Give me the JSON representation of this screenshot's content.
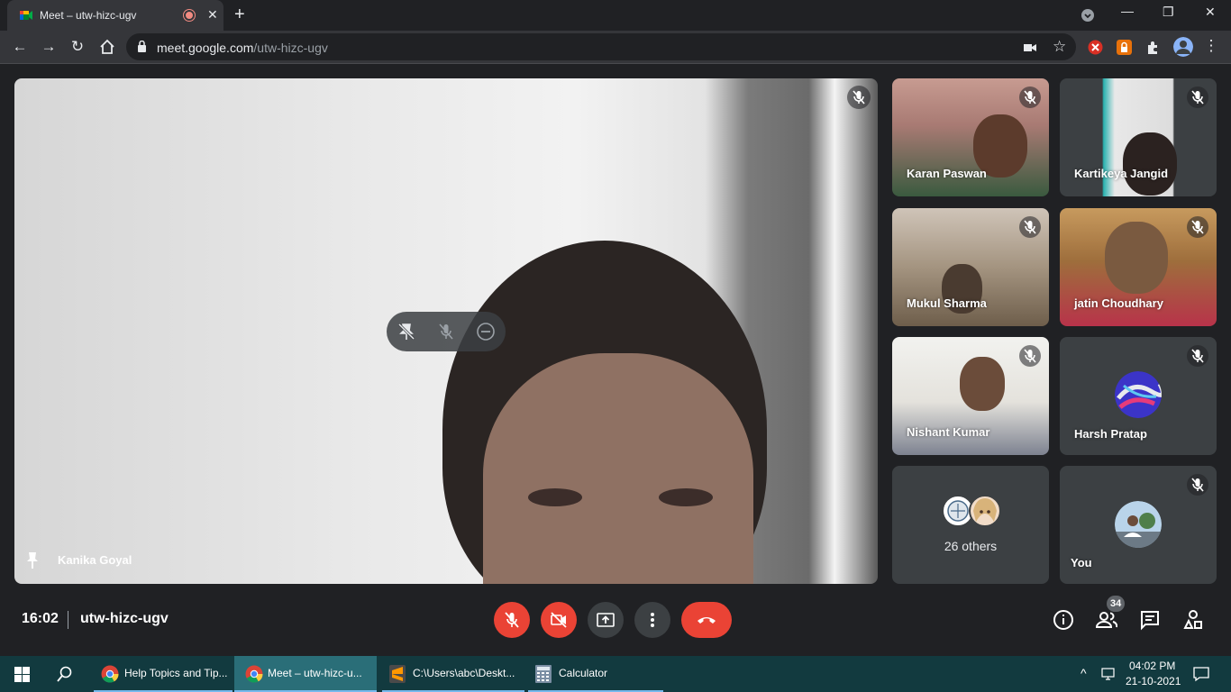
{
  "browser": {
    "tab_title": "Meet – utw-hizc-ugv",
    "url_host": "meet.google.com",
    "url_path": "/utw-hizc-ugv"
  },
  "main_speaker": {
    "name": "Kanika Goyal"
  },
  "tiles": [
    {
      "name": "Karan Paswan"
    },
    {
      "name": "Kartikeya Jangid"
    },
    {
      "name": "Mukul Sharma"
    },
    {
      "name": "jatin Choudhary"
    },
    {
      "name": "Nishant Kumar"
    },
    {
      "name": "Harsh Pratap"
    },
    {
      "name": "26 others"
    },
    {
      "name": "You"
    }
  ],
  "meeting": {
    "time": "16:02",
    "code": "utw-hizc-ugv",
    "participant_count": "34"
  },
  "taskbar": {
    "items": [
      {
        "label": "Help Topics and Tip..."
      },
      {
        "label": "Meet – utw-hizc-u..."
      },
      {
        "label": "C:\\Users\\abc\\Deskt..."
      },
      {
        "label": "Calculator"
      }
    ],
    "time": "04:02 PM",
    "date": "21-10-2021"
  },
  "colors": {
    "accent_red": "#ea4335",
    "control_grey": "#3c4043",
    "taskbar": "#123a3f"
  }
}
